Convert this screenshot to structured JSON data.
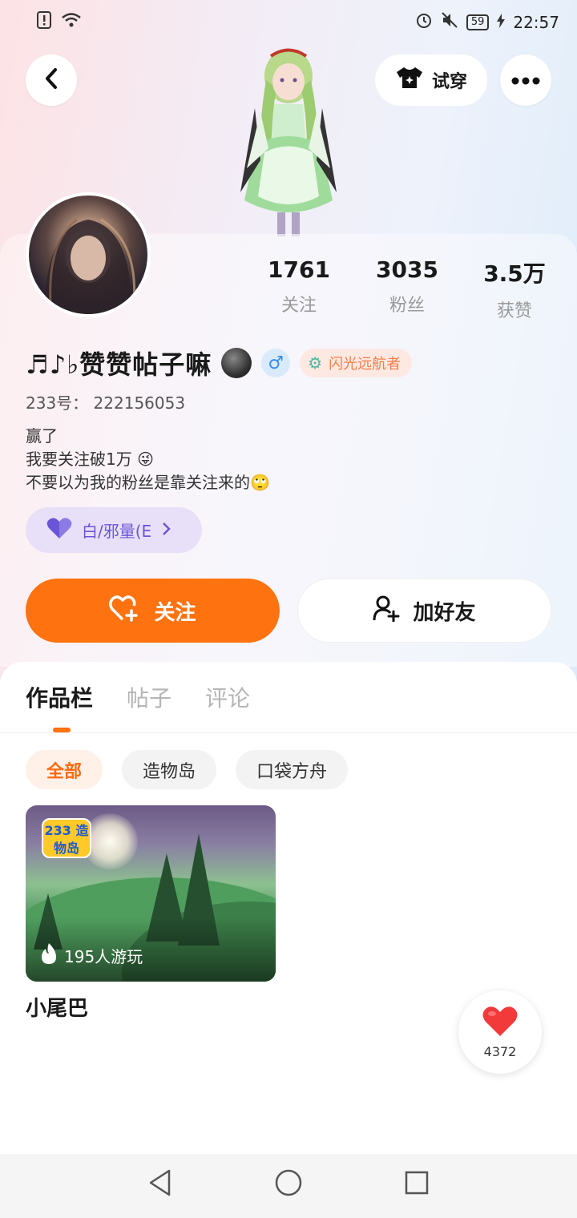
{
  "status_bar": {
    "battery": "59",
    "time": "22:57"
  },
  "header": {
    "try_on_label": "试穿"
  },
  "profile": {
    "stats": [
      {
        "value": "1761",
        "label": "关注"
      },
      {
        "value": "3035",
        "label": "粉丝"
      },
      {
        "value": "3.5万",
        "label": "获赞"
      }
    ],
    "name": "♬♪♭赞赞帖子嘛",
    "gender_symbol": "♂",
    "title_badge": "闪光远航者",
    "id_label": "233号：",
    "id_value": "222156053",
    "bio_lines": [
      "赢了",
      "我要关注破1万 😜",
      "不要以为我的粉丝是靠关注来的🙄"
    ],
    "relation_label": "白/邪量(E"
  },
  "actions": {
    "follow_label": "关注",
    "add_friend_label": "加好友"
  },
  "tabs": [
    "作品栏",
    "帖子",
    "评论"
  ],
  "filter_chips": [
    "全部",
    "造物岛",
    "口袋方舟"
  ],
  "works": [
    {
      "logo_text": "233 造物岛",
      "play_count": "195人游玩",
      "title": "小尾巴"
    }
  ],
  "like_float": {
    "count": "4372"
  },
  "colors": {
    "accent": "#ff7210",
    "relation_bg": "#e8e0f8",
    "relation_text": "#6a55d6",
    "badge_text": "#f47e4a"
  },
  "icons": [
    "back-arrow-icon",
    "tshirt-icon",
    "more-dots-icon",
    "heart-plus-icon",
    "person-add-icon",
    "heart-icon",
    "flame-icon",
    "nav-back-icon",
    "nav-home-icon",
    "nav-recent-icon"
  ]
}
